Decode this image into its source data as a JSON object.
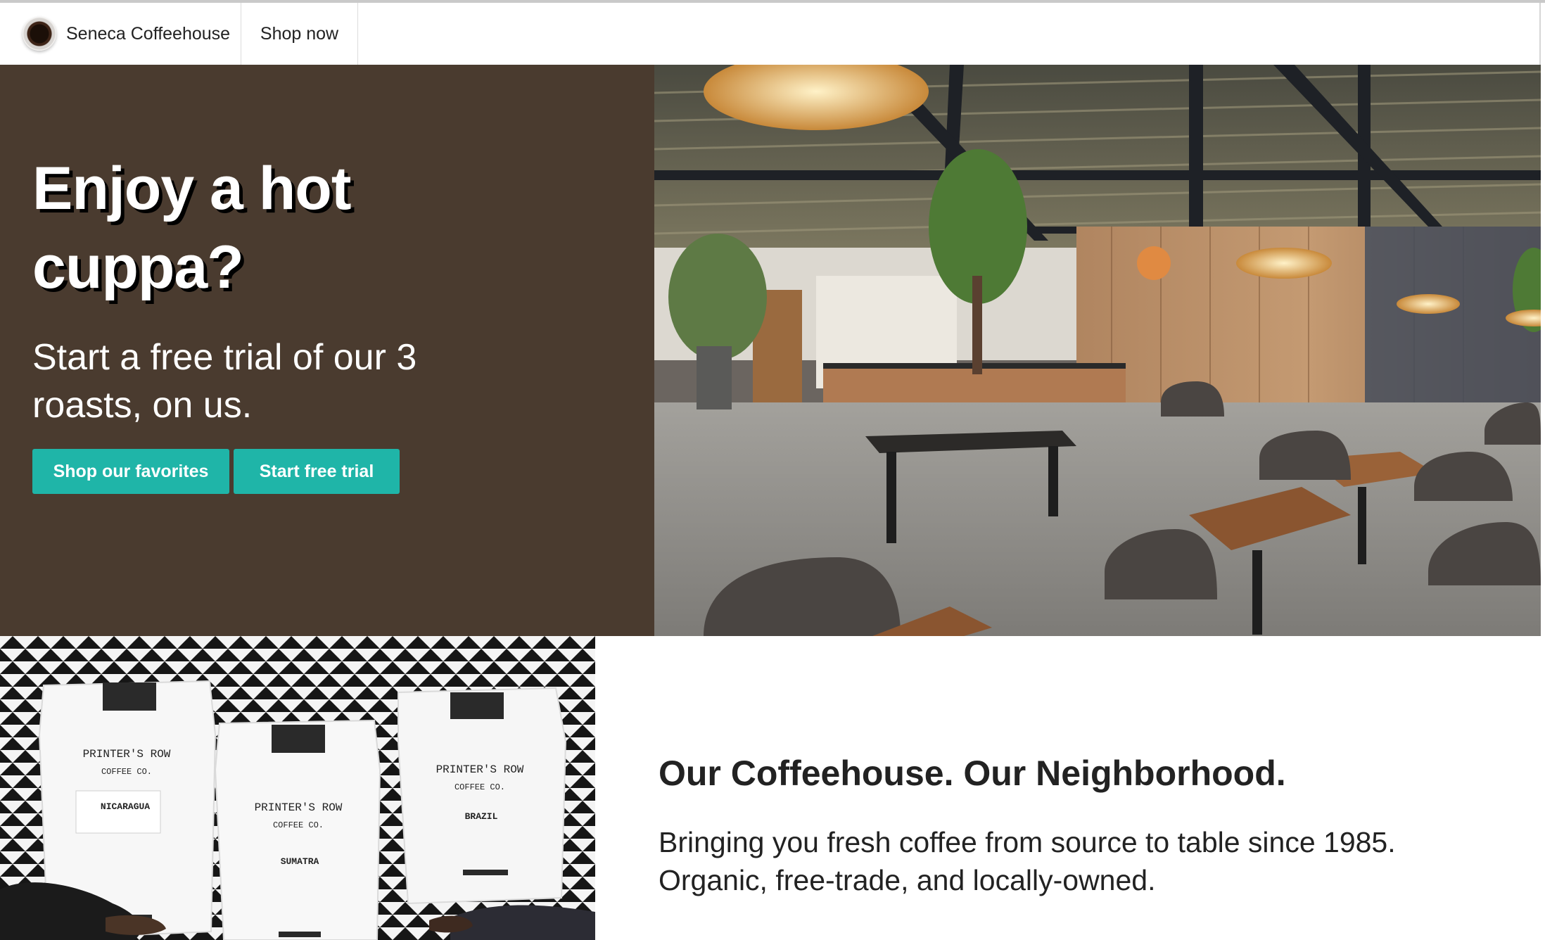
{
  "navbar": {
    "brand_name": "Seneca Coffeehouse",
    "logo_icon": "coffee-cup-icon",
    "shop_link": "Shop now"
  },
  "hero": {
    "title": "Enjoy a hot cuppa?",
    "subtitle": "Start a free trial of our 3 roasts, on us.",
    "primary_button": "Shop our favorites",
    "secondary_button": "Start free trial",
    "background_color": "#4a3b2f",
    "button_color": "#1fb5a8"
  },
  "bags": [
    {
      "brand": "PRINTER'S ROW",
      "company": "COFFEE CO.",
      "origin": "NICARAGUA"
    },
    {
      "brand": "PRINTER'S ROW",
      "company": "COFFEE CO.",
      "origin": "SUMATRA"
    },
    {
      "brand": "PRINTER'S ROW",
      "company": "COFFEE CO.",
      "origin": "BRAZIL"
    }
  ],
  "about": {
    "title": "Our Coffeehouse. Our Neighborhood.",
    "text": "Bringing you fresh coffee from source to table since 1985. Organic, free-trade, and locally-owned."
  }
}
